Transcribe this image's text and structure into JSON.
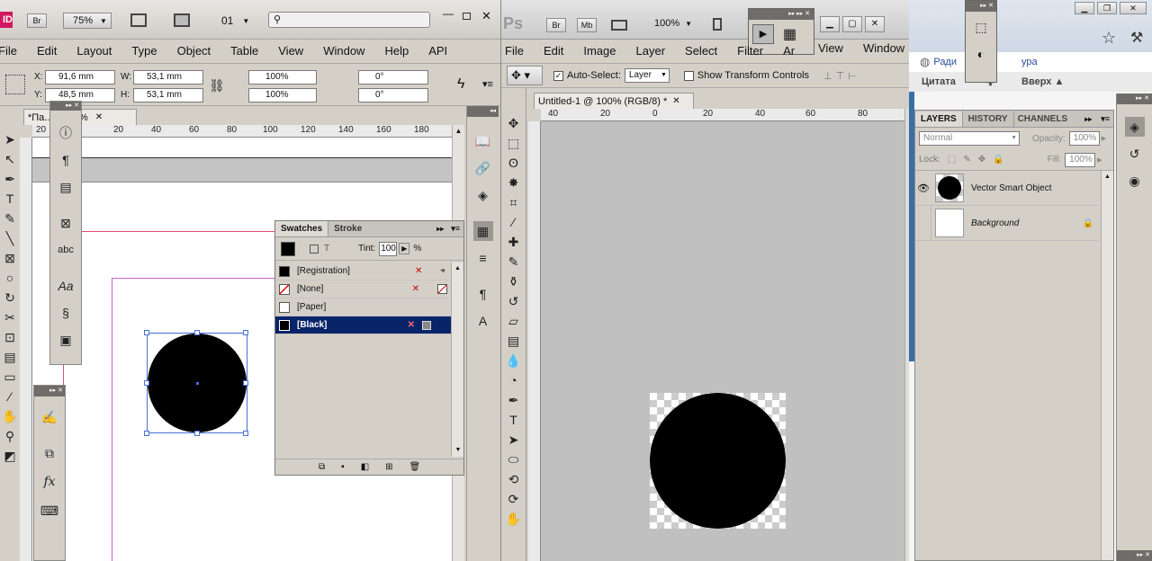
{
  "indesign": {
    "app_badge": "ID",
    "bridge_badge": "Br",
    "zoom": "75%",
    "page_field": "01",
    "menu": [
      "File",
      "Edit",
      "Layout",
      "Type",
      "Object",
      "Table",
      "View",
      "Window",
      "Help",
      "API"
    ],
    "control": {
      "x_label": "X:",
      "x_value": "91,6 mm",
      "y_label": "Y:",
      "y_value": "48,5 mm",
      "w_label": "W:",
      "w_value": "53,1 mm",
      "h_label": "H:",
      "h_value": "53,1 mm",
      "scale_x": "100%",
      "scale_y": "100%",
      "angle": "0°",
      "shear": "0°"
    },
    "doc_tab": "*Па... @ 75%",
    "ruler_ticks": [
      "20",
      "20",
      "40",
      "60",
      "80",
      "100",
      "120",
      "140",
      "160",
      "180"
    ],
    "swatches": {
      "tab_swatches": "Swatches",
      "tab_stroke": "Stroke",
      "tint_label": "Tint:",
      "tint_value": "100",
      "tint_unit": "%",
      "rows": [
        {
          "name": "[Registration]",
          "color": "#000000"
        },
        {
          "name": "[None]",
          "color": "#ffffff"
        },
        {
          "name": "[Paper]",
          "color": "#ffffff"
        },
        {
          "name": "[Black]",
          "color": "#000000"
        }
      ],
      "selected_color": "#0a246a"
    }
  },
  "photoshop": {
    "app_badge": "Ps",
    "bridge_badge": "Br",
    "mb_badge": "Mb",
    "zoom": "100%",
    "menu": [
      "File",
      "Edit",
      "Image",
      "Layer",
      "Select",
      "Filter",
      "Ar"
    ],
    "menu_right": [
      "View",
      "Window"
    ],
    "auto_select_label": "Auto-Select:",
    "auto_select_value": "Layer",
    "show_transform_label": "Show Transform Controls",
    "doc_tab": "Untitled-1 @ 100% (RGB/8) *",
    "ruler_ticks": [
      "40",
      "20",
      "0",
      "20",
      "40",
      "60",
      "80"
    ],
    "layers_panel": {
      "tabs": [
        "LAYERS",
        "HISTORY",
        "CHANNELS"
      ],
      "blend_mode": "Normal",
      "opacity_label": "Opacity:",
      "opacity_value": "100%",
      "lock_label": "Lock:",
      "fill_label": "Fill:",
      "fill_value": "100%",
      "layers": [
        {
          "name": "Vector Smart Object",
          "visible": true
        },
        {
          "name": "Background",
          "visible": false,
          "locked": true
        }
      ]
    }
  },
  "browser": {
    "link1": "Ради",
    "link2": "ура",
    "quote_btn": "Цитата",
    "up_btn": "Вверх ▲"
  },
  "colors": {
    "panel_bg": "#d4d0c8",
    "ps_canvas": "#c0c0c0",
    "selection_blue": "#0a246a",
    "frame_blue": "#4a6fd8",
    "guide_magenta": "#d060d0"
  }
}
